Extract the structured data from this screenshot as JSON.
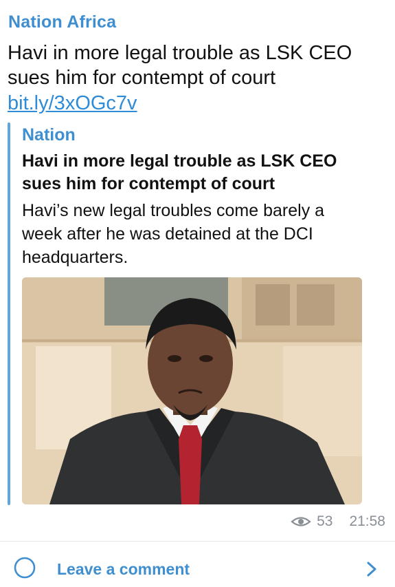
{
  "post": {
    "channel_name": "Nation Africa",
    "text": "Havi in more legal trouble as LSK CEO sues him for contempt of court",
    "link": "bit.ly/3xOGc7v"
  },
  "preview": {
    "site_name": "Nation",
    "title": "Havi in more legal trouble as LSK CEO sues him for contempt of court",
    "description": "Havi’s new legal troubles come barely a week after he was detained at the DCI headquarters.",
    "image_alt": "photo"
  },
  "meta": {
    "views": "53",
    "time": "21:58"
  },
  "comments": {
    "label": "Leave a comment"
  },
  "colors": {
    "accent": "#3f8fd0",
    "link": "#2f8bd6",
    "meta": "#8a8f96"
  }
}
